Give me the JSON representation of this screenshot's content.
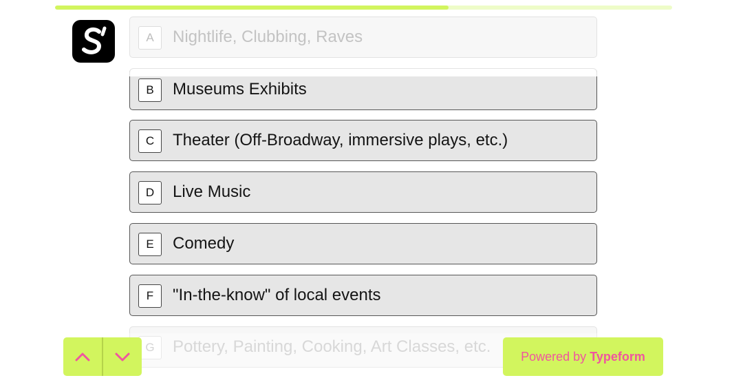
{
  "progress": {
    "percent": 63.8
  },
  "brand": {
    "logo_letter": "S"
  },
  "choices": [
    {
      "key": "A",
      "label": "Nightlife, Clubbing, Raves"
    },
    {
      "key": "B",
      "label": "Museums Exhibits"
    },
    {
      "key": "C",
      "label": "Theater (Off-Broadway, immersive plays, etc.)"
    },
    {
      "key": "D",
      "label": "Live Music"
    },
    {
      "key": "E",
      "label": "Comedy"
    },
    {
      "key": "F",
      "label": "\"In-the-know\" of local events"
    },
    {
      "key": "G",
      "label": "Pottery, Painting, Cooking, Art Classes, etc."
    }
  ],
  "navigation": {
    "up_icon": "chevron-up-icon",
    "down_icon": "chevron-down-icon"
  },
  "footer": {
    "powered_prefix": "Powered by",
    "powered_brand": "Typeform"
  },
  "colors": {
    "accent": "#d2f55e",
    "accent_text": "#f0559f",
    "choice_bg": "#e6e6e6",
    "choice_border": "#555555"
  }
}
